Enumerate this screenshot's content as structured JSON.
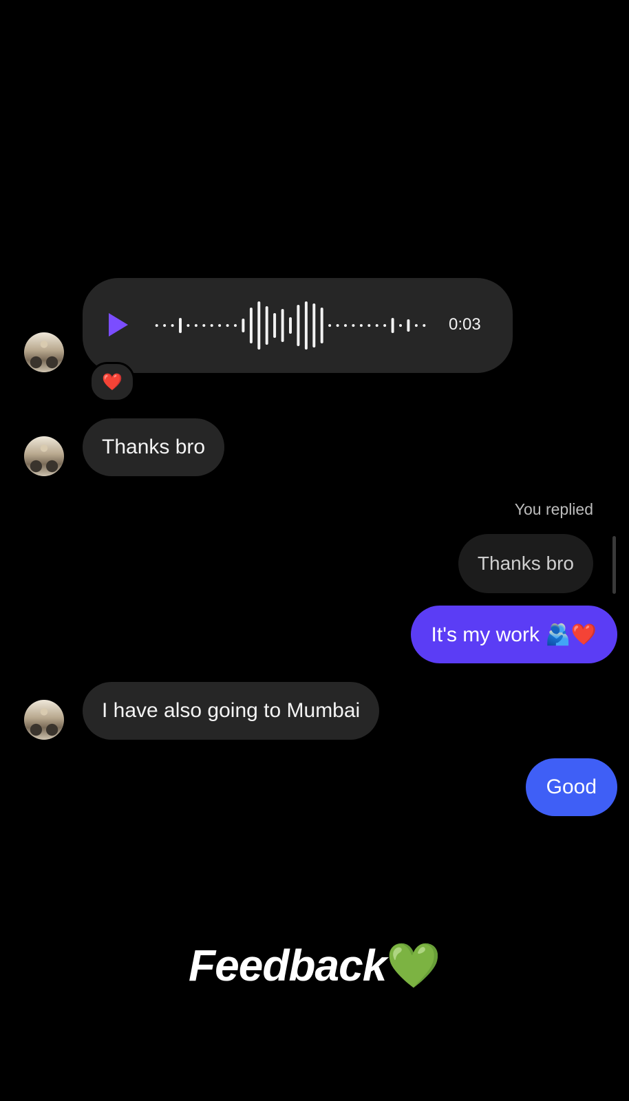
{
  "voice_message": {
    "duration": "0:03",
    "reaction": "❤️"
  },
  "messages": [
    {
      "text": "Thanks bro"
    },
    {
      "text": "I have also going to Mumbai"
    }
  ],
  "reply": {
    "label": "You replied",
    "quoted": "Thanks bro"
  },
  "outgoing": [
    {
      "text": "It's my work 🫂❤️"
    },
    {
      "text": "Good"
    }
  ],
  "caption": {
    "text": "Feedback",
    "emoji": "💚"
  },
  "colors": {
    "play_accent": "#7b4dff",
    "outgoing_purple": "#5b3df5",
    "outgoing_blue": "#3f5ff6",
    "incoming_bubble": "#262626"
  }
}
